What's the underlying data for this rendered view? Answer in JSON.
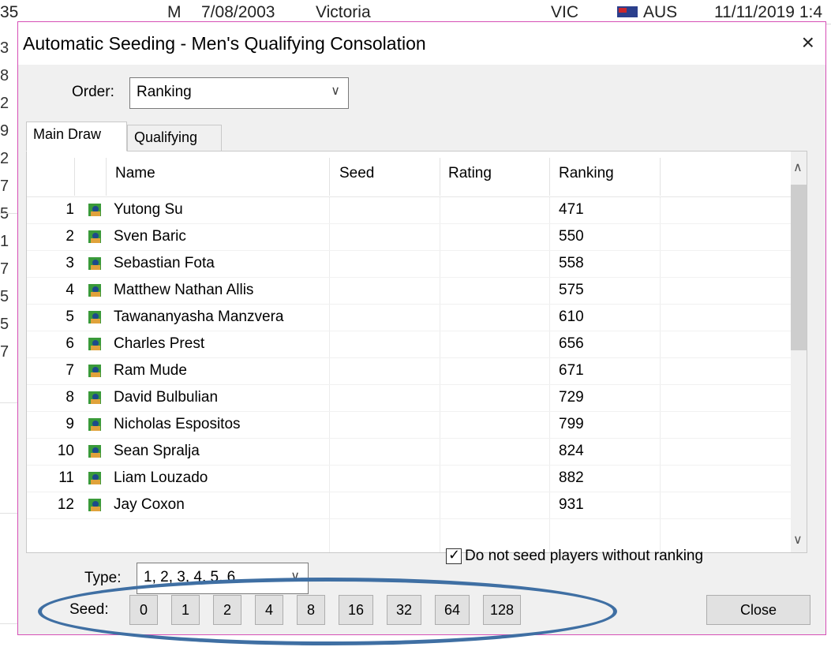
{
  "background": {
    "row_cells": [
      "35",
      "M",
      "7/08/2003",
      "Victoria",
      "VIC",
      "AUS",
      "11/11/2019 1:4"
    ],
    "left_col": [
      "3",
      "8",
      "2",
      "9",
      "2",
      "7",
      "5",
      "1",
      "7",
      "5",
      "5",
      "7"
    ]
  },
  "dialog": {
    "title": "Automatic Seeding - Men's Qualifying Consolation",
    "close_glyph": "×",
    "order_label": "Order:",
    "order_value": "Ranking",
    "tabs": [
      {
        "label": "Main Draw",
        "active": true
      },
      {
        "label": "Qualifying",
        "active": false
      }
    ],
    "columns": {
      "name": "Name",
      "seed": "Seed",
      "rating": "Rating",
      "ranking": "Ranking"
    },
    "rows": [
      {
        "idx": "1",
        "name": "Yutong Su",
        "seed": "",
        "rating": "",
        "ranking": "471"
      },
      {
        "idx": "2",
        "name": "Sven Baric",
        "seed": "",
        "rating": "",
        "ranking": "550"
      },
      {
        "idx": "3",
        "name": "Sebastian Fota",
        "seed": "",
        "rating": "",
        "ranking": "558"
      },
      {
        "idx": "4",
        "name": "Matthew Nathan Allis",
        "seed": "",
        "rating": "",
        "ranking": "575"
      },
      {
        "idx": "5",
        "name": "Tawananyasha Manzvera",
        "seed": "",
        "rating": "",
        "ranking": "610"
      },
      {
        "idx": "6",
        "name": "Charles Prest",
        "seed": "",
        "rating": "",
        "ranking": "656"
      },
      {
        "idx": "7",
        "name": "Ram Mude",
        "seed": "",
        "rating": "",
        "ranking": "671"
      },
      {
        "idx": "8",
        "name": "David Bulbulian",
        "seed": "",
        "rating": "",
        "ranking": "729"
      },
      {
        "idx": "9",
        "name": "Nicholas Espositos",
        "seed": "",
        "rating": "",
        "ranking": "799"
      },
      {
        "idx": "10",
        "name": "Sean Spralja",
        "seed": "",
        "rating": "",
        "ranking": "824"
      },
      {
        "idx": "11",
        "name": "Liam Louzado",
        "seed": "",
        "rating": "",
        "ranking": "882"
      },
      {
        "idx": "12",
        "name": "Jay Coxon",
        "seed": "",
        "rating": "",
        "ranking": "931"
      }
    ],
    "type_label": "Type:",
    "type_value": "1, 2, 3, 4, 5, 6...",
    "checkbox_label": "Do not seed players without ranking",
    "checkbox_checked": true,
    "seed_label": "Seed:",
    "seed_buttons": [
      "0",
      "1",
      "2",
      "4",
      "8",
      "16",
      "32",
      "64",
      "128"
    ],
    "close_button": "Close"
  },
  "colors": {
    "dialog_border": "#d64fb6",
    "annotation_oval": "#3f6fa3"
  }
}
